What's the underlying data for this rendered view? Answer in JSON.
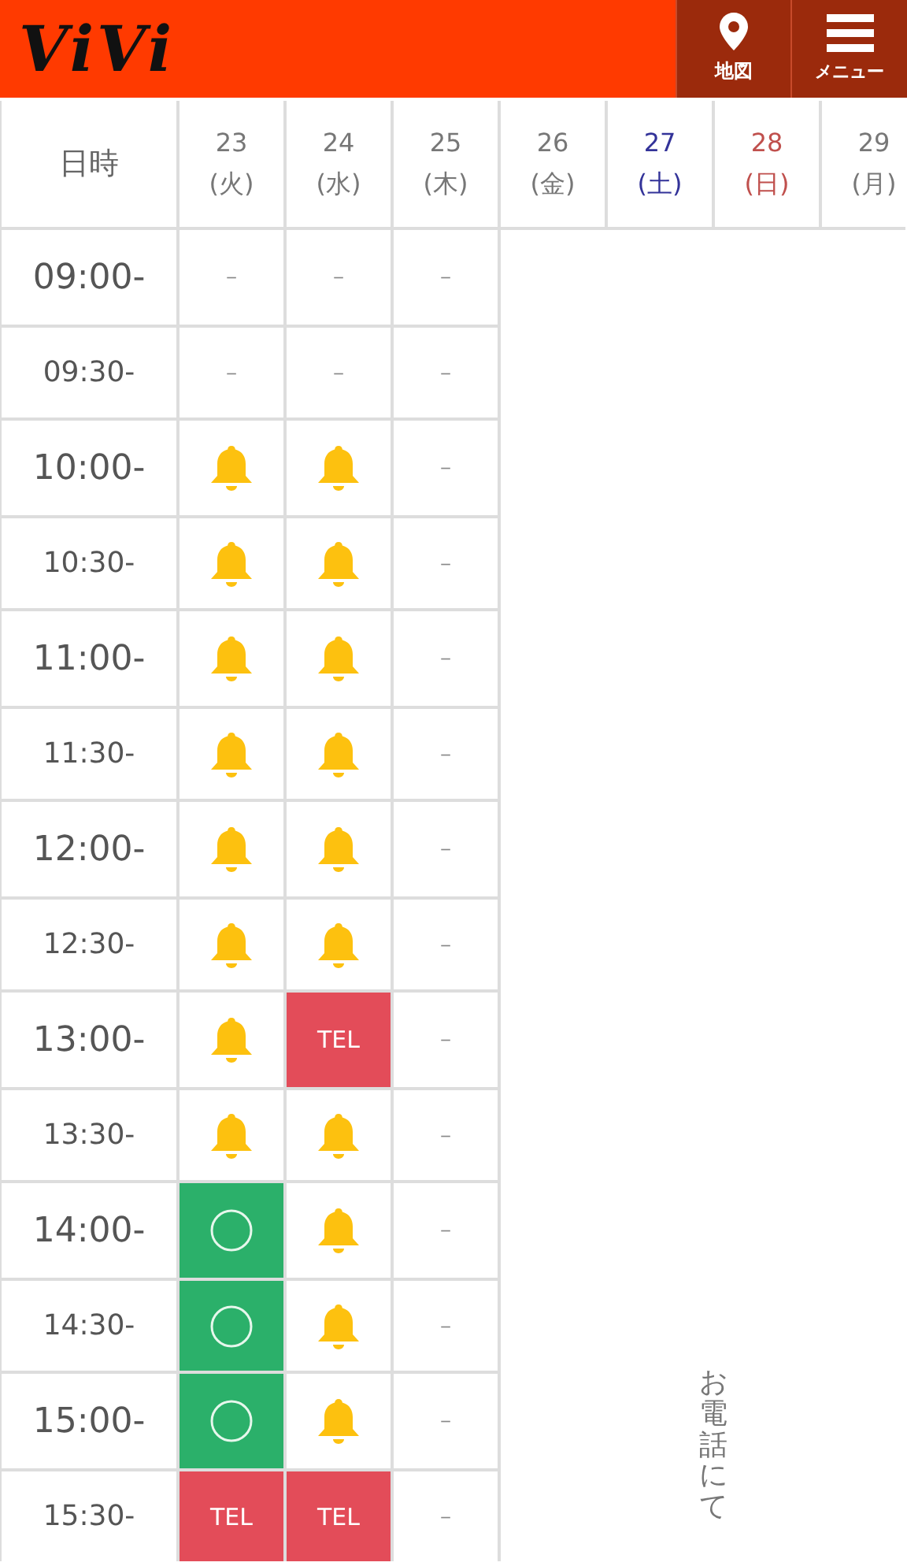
{
  "header": {
    "logo": "ViVi",
    "buttons": [
      {
        "kind": "map",
        "label": "地図"
      },
      {
        "kind": "menu",
        "label": "メニュー"
      }
    ]
  },
  "table": {
    "corner": "日時",
    "days": [
      {
        "date": "23",
        "weekday": "(火)",
        "color": "#777777"
      },
      {
        "date": "24",
        "weekday": "(水)",
        "color": "#777777"
      },
      {
        "date": "25",
        "weekday": "(木)",
        "color": "#777777"
      },
      {
        "date": "26",
        "weekday": "(金)",
        "color": "#777777"
      },
      {
        "date": "27",
        "weekday": "(土)",
        "color": "#333399"
      },
      {
        "date": "28",
        "weekday": "(日)",
        "color": "#c0504d"
      },
      {
        "date": "29",
        "weekday": "(月)",
        "color": "#777777"
      }
    ],
    "closed_note": "お電話にて",
    "rows": [
      {
        "time": "09:00-",
        "kind": "hour",
        "cells": [
          {
            "kind": "dash",
            "text": "－"
          },
          {
            "kind": "dash",
            "text": "－"
          },
          {
            "kind": "dash",
            "text": "－"
          }
        ]
      },
      {
        "time": "09:30-",
        "kind": "half",
        "cells": [
          {
            "kind": "dash",
            "text": "－"
          },
          {
            "kind": "dash",
            "text": "－"
          },
          {
            "kind": "dash",
            "text": "－"
          }
        ]
      },
      {
        "time": "10:00-",
        "kind": "hour",
        "cells": [
          {
            "kind": "bell"
          },
          {
            "kind": "bell"
          },
          {
            "kind": "dash",
            "text": "－"
          }
        ]
      },
      {
        "time": "10:30-",
        "kind": "half",
        "cells": [
          {
            "kind": "bell"
          },
          {
            "kind": "bell"
          },
          {
            "kind": "dash",
            "text": "－"
          }
        ]
      },
      {
        "time": "11:00-",
        "kind": "hour",
        "cells": [
          {
            "kind": "bell"
          },
          {
            "kind": "bell"
          },
          {
            "kind": "dash",
            "text": "－"
          }
        ]
      },
      {
        "time": "11:30-",
        "kind": "half",
        "cells": [
          {
            "kind": "bell"
          },
          {
            "kind": "bell"
          },
          {
            "kind": "dash",
            "text": "－"
          }
        ]
      },
      {
        "time": "12:00-",
        "kind": "hour",
        "cells": [
          {
            "kind": "bell"
          },
          {
            "kind": "bell"
          },
          {
            "kind": "dash",
            "text": "－"
          }
        ]
      },
      {
        "time": "12:30-",
        "kind": "half",
        "cells": [
          {
            "kind": "bell"
          },
          {
            "kind": "bell"
          },
          {
            "kind": "dash",
            "text": "－"
          }
        ]
      },
      {
        "time": "13:00-",
        "kind": "hour",
        "cells": [
          {
            "kind": "bell"
          },
          {
            "kind": "tel",
            "text": "TEL"
          },
          {
            "kind": "dash",
            "text": "－"
          }
        ]
      },
      {
        "time": "13:30-",
        "kind": "half",
        "cells": [
          {
            "kind": "bell"
          },
          {
            "kind": "bell"
          },
          {
            "kind": "dash",
            "text": "－"
          }
        ]
      },
      {
        "time": "14:00-",
        "kind": "hour",
        "cells": [
          {
            "kind": "circle"
          },
          {
            "kind": "bell"
          },
          {
            "kind": "dash",
            "text": "－"
          }
        ]
      },
      {
        "time": "14:30-",
        "kind": "half",
        "cells": [
          {
            "kind": "circle"
          },
          {
            "kind": "bell"
          },
          {
            "kind": "dash",
            "text": "－"
          }
        ]
      },
      {
        "time": "15:00-",
        "kind": "hour",
        "cells": [
          {
            "kind": "circle"
          },
          {
            "kind": "bell"
          },
          {
            "kind": "dash",
            "text": "－"
          }
        ]
      },
      {
        "time": "15:30-",
        "kind": "half",
        "cells": [
          {
            "kind": "tel",
            "text": "TEL"
          },
          {
            "kind": "tel",
            "text": "TEL"
          },
          {
            "kind": "dash",
            "text": "－"
          }
        ]
      }
    ]
  }
}
